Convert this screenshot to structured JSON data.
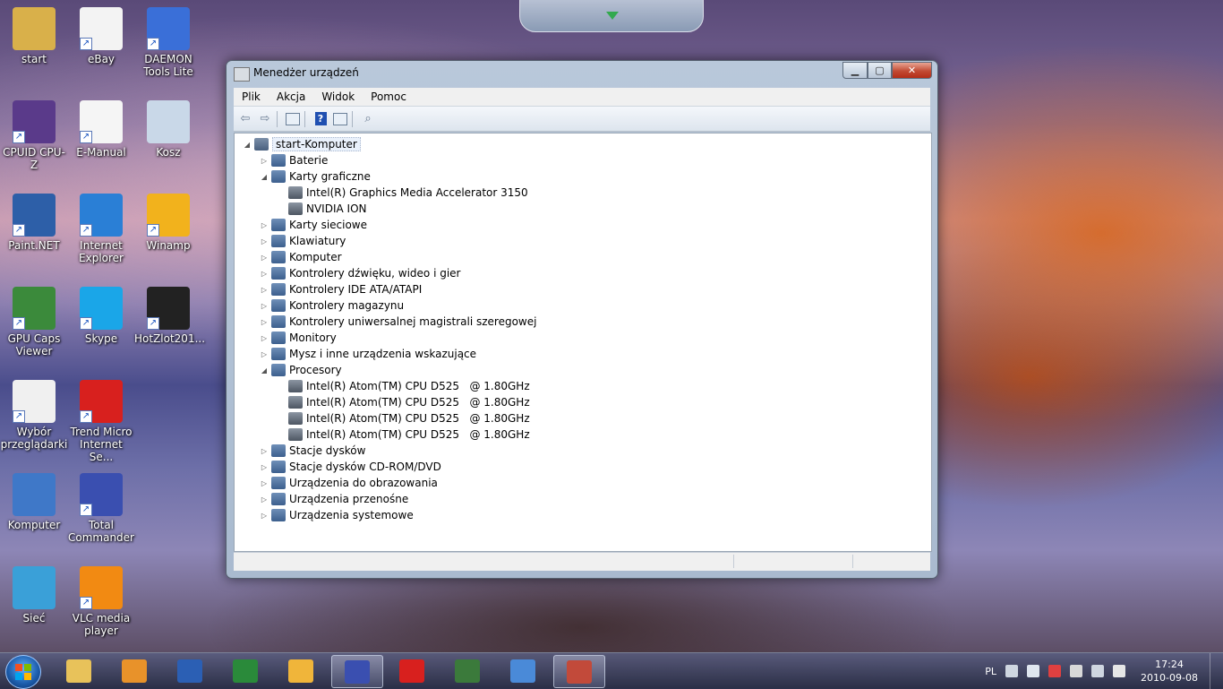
{
  "desktop": {
    "icons": [
      {
        "label": "start",
        "icon": "user-folder-icon"
      },
      {
        "label": "eBay",
        "icon": "ebay-icon"
      },
      {
        "label": "DAEMON Tools Lite",
        "icon": "daemon-tools-icon"
      },
      {
        "label": "CPUID CPU-Z",
        "icon": "cpuz-icon"
      },
      {
        "label": "E-Manual",
        "icon": "pdf-manual-icon"
      },
      {
        "label": "Kosz",
        "icon": "recycle-bin-icon"
      },
      {
        "label": "Paint.NET",
        "icon": "paint-net-icon"
      },
      {
        "label": "Internet Explorer",
        "icon": "internet-explorer-icon"
      },
      {
        "label": "Winamp",
        "icon": "winamp-icon"
      },
      {
        "label": "GPU Caps Viewer",
        "icon": "gpu-caps-icon"
      },
      {
        "label": "Skype",
        "icon": "skype-icon"
      },
      {
        "label": "HotZlot201...",
        "icon": "video-file-icon"
      },
      {
        "label": "Wybór przeglądarki",
        "icon": "browser-choice-icon"
      },
      {
        "label": "Trend Micro Internet Se...",
        "icon": "trend-micro-icon"
      },
      {
        "label": "Komputer",
        "icon": "computer-icon"
      },
      {
        "label": "Total Commander",
        "icon": "floppy-disk-icon"
      },
      {
        "label": "Sieć",
        "icon": "network-icon"
      },
      {
        "label": "VLC media player",
        "icon": "vlc-icon"
      }
    ]
  },
  "window": {
    "title": "Menedżer urządzeń",
    "controls": {
      "minimize": "▁",
      "maximize": "▢",
      "close": "✕"
    },
    "menu": [
      "Plik",
      "Akcja",
      "Widok",
      "Pomoc"
    ],
    "toolbar": [
      "back-arrow-icon",
      "forward-arrow-icon",
      "properties-icon",
      "help-icon",
      "view-icon",
      "scan-hardware-icon"
    ],
    "tree": {
      "root": "start-Komputer",
      "nodes": [
        {
          "label": "Baterie",
          "expanded": false
        },
        {
          "label": "Karty graficzne",
          "expanded": true,
          "children": [
            "Intel(R) Graphics Media Accelerator 3150",
            "NVIDIA ION"
          ]
        },
        {
          "label": "Karty sieciowe",
          "expanded": false
        },
        {
          "label": "Klawiatury",
          "expanded": false
        },
        {
          "label": "Komputer",
          "expanded": false
        },
        {
          "label": "Kontrolery dźwięku, wideo i gier",
          "expanded": false
        },
        {
          "label": "Kontrolery IDE ATA/ATAPI",
          "expanded": false
        },
        {
          "label": "Kontrolery magazynu",
          "expanded": false
        },
        {
          "label": "Kontrolery uniwersalnej magistrali szeregowej",
          "expanded": false
        },
        {
          "label": "Monitory",
          "expanded": false
        },
        {
          "label": "Mysz i inne urządzenia wskazujące",
          "expanded": false
        },
        {
          "label": "Procesory",
          "expanded": true,
          "children": [
            "Intel(R) Atom(TM) CPU D525   @ 1.80GHz",
            "Intel(R) Atom(TM) CPU D525   @ 1.80GHz",
            "Intel(R) Atom(TM) CPU D525   @ 1.80GHz",
            "Intel(R) Atom(TM) CPU D525   @ 1.80GHz"
          ]
        },
        {
          "label": "Stacje dysków",
          "expanded": false
        },
        {
          "label": "Stacje dysków CD-ROM/DVD",
          "expanded": false
        },
        {
          "label": "Urządzenia do obrazowania",
          "expanded": false
        },
        {
          "label": "Urządzenia przenośne",
          "expanded": false
        },
        {
          "label": "Urządzenia systemowe",
          "expanded": false
        }
      ]
    }
  },
  "taskbar": {
    "apps": [
      {
        "icon": "explorer-folder-icon",
        "active": false
      },
      {
        "icon": "media-player-icon",
        "active": false
      },
      {
        "icon": "word-icon",
        "active": false
      },
      {
        "icon": "excel-icon",
        "active": false
      },
      {
        "icon": "outlook-icon",
        "active": false
      },
      {
        "icon": "total-commander-icon",
        "active": true
      },
      {
        "icon": "trend-micro-icon",
        "active": false
      },
      {
        "icon": "gpu-caps-icon",
        "active": false
      },
      {
        "icon": "control-panel-icon",
        "active": false
      },
      {
        "icon": "device-manager-icon",
        "active": true
      }
    ],
    "tray": {
      "language": "PL",
      "icons": [
        "keyboard-icon",
        "show-hidden-icons-icon",
        "network-error-icon",
        "power-icon",
        "signal-icon",
        "volume-icon"
      ],
      "time": "17:24",
      "date": "2010-09-08"
    }
  }
}
